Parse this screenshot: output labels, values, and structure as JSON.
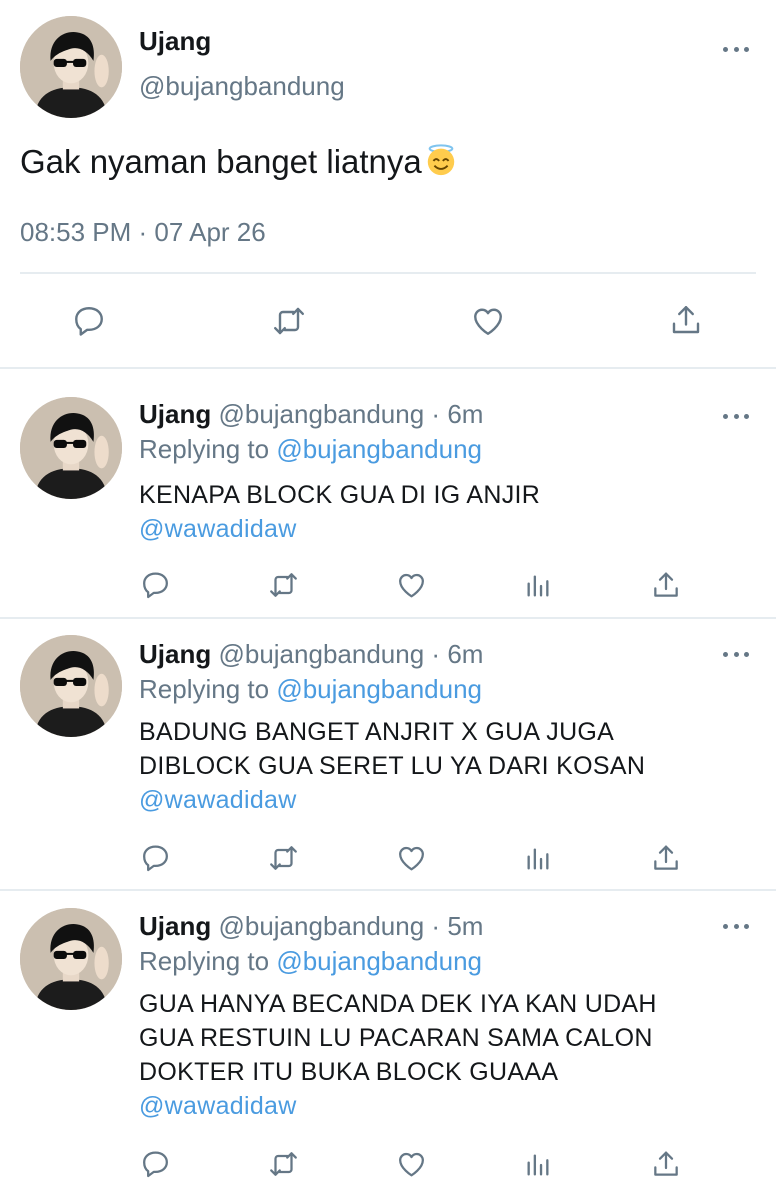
{
  "main_tweet": {
    "name": "Ujang",
    "handle": "@bujangbandung",
    "text": "Gak nyaman banget liatnya",
    "emoji": "innocent-face-emoji",
    "timestamp": "08:53 PM · 07 Apr 26"
  },
  "replies": [
    {
      "name": "Ujang",
      "handle": "@bujangbandung",
      "dot": "·",
      "time": "6m",
      "replying_prefix": "Replying to ",
      "replying_to": "@bujangbandung",
      "lines": [
        "KENAPA BLOCK GUA DI IG ANJIR"
      ],
      "mention": "@wawadidaw"
    },
    {
      "name": "Ujang",
      "handle": "@bujangbandung",
      "dot": "·",
      "time": "6m",
      "replying_prefix": "Replying to ",
      "replying_to": "@bujangbandung",
      "lines": [
        "BADUNG BANGET ANJRIT X GUA JUGA",
        "DIBLOCK GUA SERET LU YA DARI KOSAN"
      ],
      "mention": "@wawadidaw"
    },
    {
      "name": "Ujang",
      "handle": "@bujangbandung",
      "dot": "·",
      "time": "5m",
      "replying_prefix": "Replying to ",
      "replying_to": "@bujangbandung",
      "lines": [
        "GUA HANYA BECANDA DEK IYA KAN UDAH",
        "GUA RESTUIN LU PACARAN SAMA CALON",
        "DOKTER ITU BUKA BLOCK GUAAA"
      ],
      "mention": "@wawadidaw"
    }
  ],
  "icons": {
    "reply": "reply-icon",
    "retweet": "retweet-icon",
    "like": "like-icon",
    "analytics": "analytics-icon",
    "share": "share-icon",
    "more": "more-icon"
  },
  "colors": {
    "link": "#4a9be0",
    "muted": "#657786",
    "text": "#14171a",
    "divider": "#e6ecf0"
  }
}
